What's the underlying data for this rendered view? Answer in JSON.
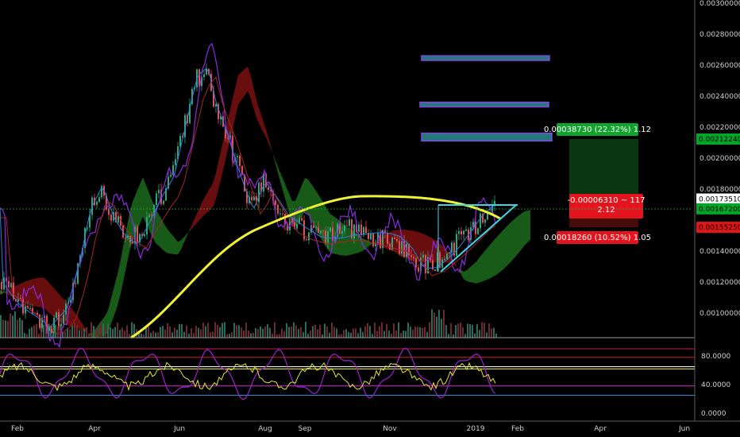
{
  "chart_data": {
    "type": "candlestick",
    "price_axis": {
      "ticks": [
        "0.00300000",
        "0.00280000",
        "0.00260000",
        "0.00240000",
        "0.00220000",
        "0.00200000",
        "0.00180000",
        "0.00140000",
        "0.00120000",
        "0.00100000"
      ],
      "ylim": [
        0.00084,
        0.00302
      ]
    },
    "price_tags": [
      {
        "label": "0.00212240",
        "value": 0.0021224,
        "color": "#00a82a"
      },
      {
        "label": "0.00173510",
        "value": 0.0017351,
        "color": "#ffffff"
      },
      {
        "label": "0.00167200",
        "value": 0.001672,
        "color": "#00a82a"
      },
      {
        "label": "0.00155250",
        "value": 0.0015525,
        "color": "#e01515"
      }
    ],
    "position": {
      "target_label": "0.00038730 (22.32%) 1.12",
      "center_label_1": "-0.00006310 ~ 117",
      "center_label_2": "2.12",
      "stop_label": "0.00018260 (10.52%) 1.05"
    },
    "x_axis": {
      "labels": [
        "Feb",
        "Apr",
        "Jun",
        "Aug",
        "Sep",
        "Nov",
        "2019",
        "Feb",
        "Apr",
        "Jun"
      ]
    },
    "rsi_axis": {
      "ticks": [
        "80.0000",
        "40.0000",
        "0.0000"
      ],
      "ylim": [
        0,
        100
      ]
    },
    "rsi_levels": [
      {
        "value": 90,
        "color": "#c3184b"
      },
      {
        "value": 78,
        "color": "#cc2222"
      },
      {
        "value": 65,
        "color": "#ffffff"
      },
      {
        "value": 62,
        "color": "#ffff3d"
      },
      {
        "value": 38,
        "color": "#d62bd6"
      },
      {
        "value": 25,
        "color": "#2d8fd6"
      }
    ],
    "resistance_zones": [
      {
        "low": 0.00263,
        "high": 0.00266
      },
      {
        "low": 0.00233,
        "high": 0.00236
      },
      {
        "low": 0.00211,
        "high": 0.00216
      }
    ],
    "colors": {
      "up": "#2fa67c",
      "down": "#e0505a",
      "ma": "#f2f234",
      "overlay": "#8a2be2",
      "cloud_green": "#1c6b1c",
      "cloud_red": "#7a1111",
      "trendline": "#3ad6e6",
      "zone_fill": "#227a7a",
      "zone_border": "#8a44e8"
    }
  }
}
